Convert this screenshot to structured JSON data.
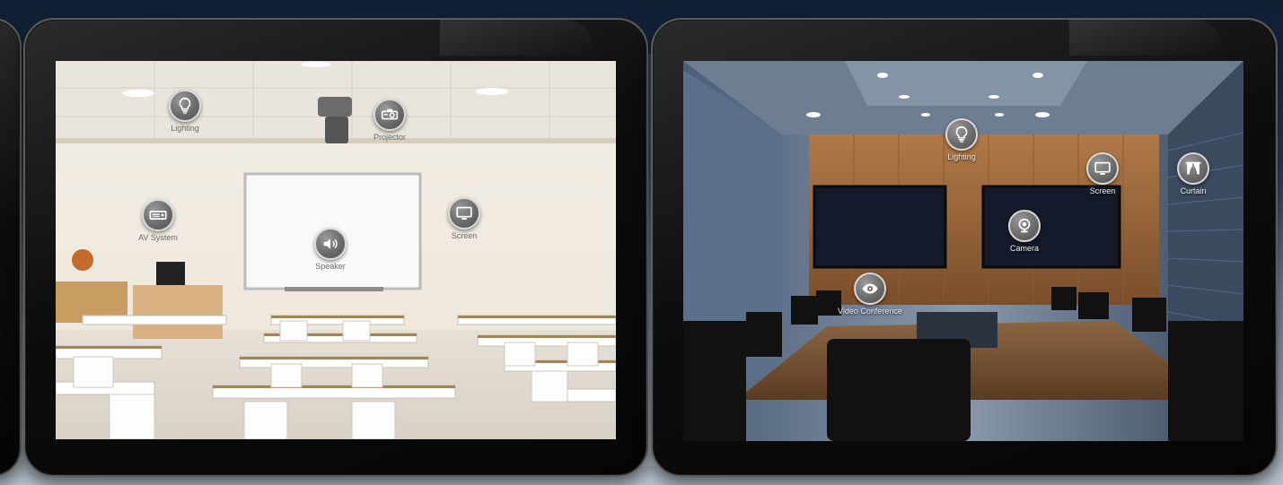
{
  "classroom": {
    "devices": [
      {
        "id": "lighting",
        "label": "Lighting",
        "icon": "lightbulb-icon"
      },
      {
        "id": "projector",
        "label": "Projector",
        "icon": "projector-icon"
      },
      {
        "id": "av-system",
        "label": "AV System",
        "icon": "av-system-icon"
      },
      {
        "id": "screen",
        "label": "Screen",
        "icon": "screen-icon"
      },
      {
        "id": "speaker",
        "label": "Speaker",
        "icon": "speaker-icon"
      }
    ]
  },
  "conference": {
    "devices": [
      {
        "id": "lighting",
        "label": "Lighting",
        "icon": "lightbulb-icon"
      },
      {
        "id": "screen",
        "label": "Screen",
        "icon": "screen-icon"
      },
      {
        "id": "curtain",
        "label": "Curtain",
        "icon": "curtain-icon"
      },
      {
        "id": "camera",
        "label": "Camera",
        "icon": "camera-icon"
      },
      {
        "id": "video-conference",
        "label": "Video Conference",
        "icon": "eye-icon"
      }
    ]
  }
}
